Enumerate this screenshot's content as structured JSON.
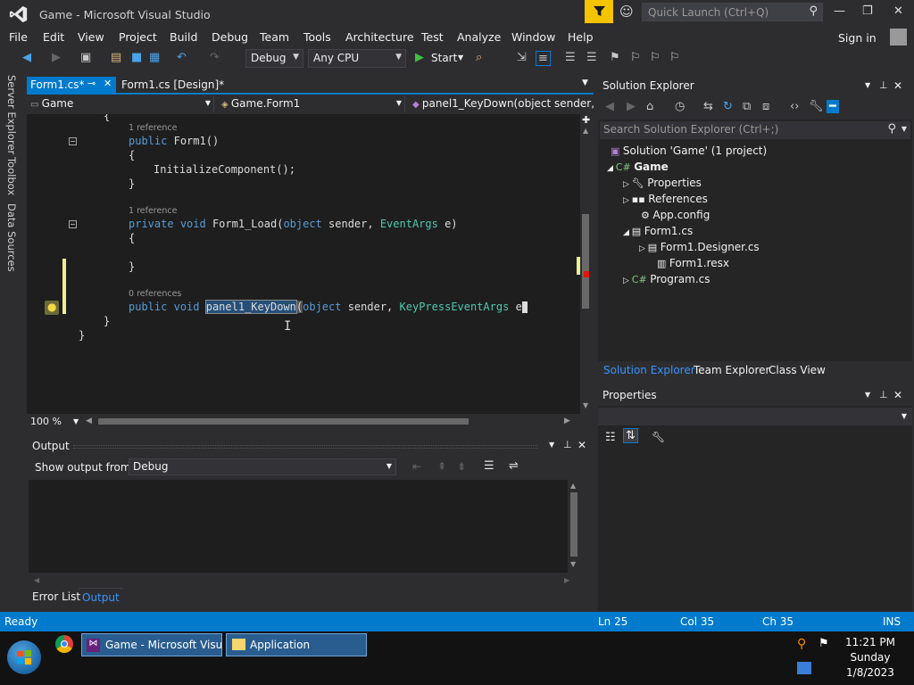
{
  "window": {
    "title": "Game - Microsoft Visual Studio",
    "quick_launch_placeholder": "Quick Launch (Ctrl+Q)"
  },
  "menu": [
    "File",
    "Edit",
    "View",
    "Project",
    "Build",
    "Debug",
    "Team",
    "Tools",
    "Architecture",
    "Test",
    "Analyze",
    "Window",
    "Help"
  ],
  "account": {
    "sign_in": "Sign in"
  },
  "toolbar": {
    "config": "Debug",
    "platform": "Any CPU",
    "start_label": "Start"
  },
  "left_tabs": [
    "Server Explorer",
    "Toolbox",
    "Data Sources"
  ],
  "editor_tabs": [
    {
      "label": "Form1.cs*",
      "active": true
    },
    {
      "label": "Form1.cs [Design]*",
      "active": false
    }
  ],
  "navbar": {
    "project": "Game",
    "class": "Game.Form1",
    "member": "panel1_KeyDown(object sender,"
  },
  "code": {
    "ref1": "1 reference",
    "ctor_kw": "public",
    "ctor_name": "Form1()",
    "open_brace": "{",
    "close_brace": "}",
    "init_call": "InitializeComponent();",
    "ref2": "1 reference",
    "load_kw1": "private",
    "load_kw2": "void",
    "load_name": "Form1_Load(",
    "load_kw3": "object",
    "load_sender": " sender, ",
    "load_type": "EventArgs",
    "load_e": " e)",
    "ref3": "0 references",
    "kd_kw1": "public",
    "kd_kw2": "void",
    "kd_name": "panel1_KeyDown",
    "kd_paren": "(",
    "kd_kw3": "object",
    "kd_sender": " sender, ",
    "kd_type": "KeyPressEventArgs",
    "kd_e": " e"
  },
  "editor_zoom": "100 %",
  "output": {
    "title": "Output",
    "show_from_label": "Show output from:",
    "source": "Debug"
  },
  "bottom_tabs": [
    "Error List",
    "Output"
  ],
  "solution_explorer": {
    "title": "Solution Explorer",
    "search_placeholder": "Search Solution Explorer (Ctrl+;)",
    "tree": [
      {
        "label": "Solution 'Game' (1 project)",
        "depth": 0
      },
      {
        "label": "Game",
        "depth": 1
      },
      {
        "label": "Properties",
        "depth": 2
      },
      {
        "label": "References",
        "depth": 2
      },
      {
        "label": "App.config",
        "depth": 2
      },
      {
        "label": "Form1.cs",
        "depth": 2
      },
      {
        "label": "Form1.Designer.cs",
        "depth": 3
      },
      {
        "label": "Form1.resx",
        "depth": 3
      },
      {
        "label": "Program.cs",
        "depth": 2
      }
    ],
    "tabs": [
      "Solution Explorer",
      "Team Explorer",
      "Class View"
    ]
  },
  "properties": {
    "title": "Properties"
  },
  "status": {
    "state": "Ready",
    "line": "Ln 25",
    "col": "Col 35",
    "ch": "Ch 35",
    "mode": "INS"
  },
  "taskbar": {
    "buttons": [
      "Game - Microsoft Visu...",
      "Application"
    ],
    "time": "11:21 PM",
    "day": "Sunday",
    "date": "1/8/2023"
  },
  "colors": {
    "accent": "#007acc",
    "keyword": "#569cd6",
    "type": "#4ec9b0",
    "notify": "#f5c400"
  }
}
